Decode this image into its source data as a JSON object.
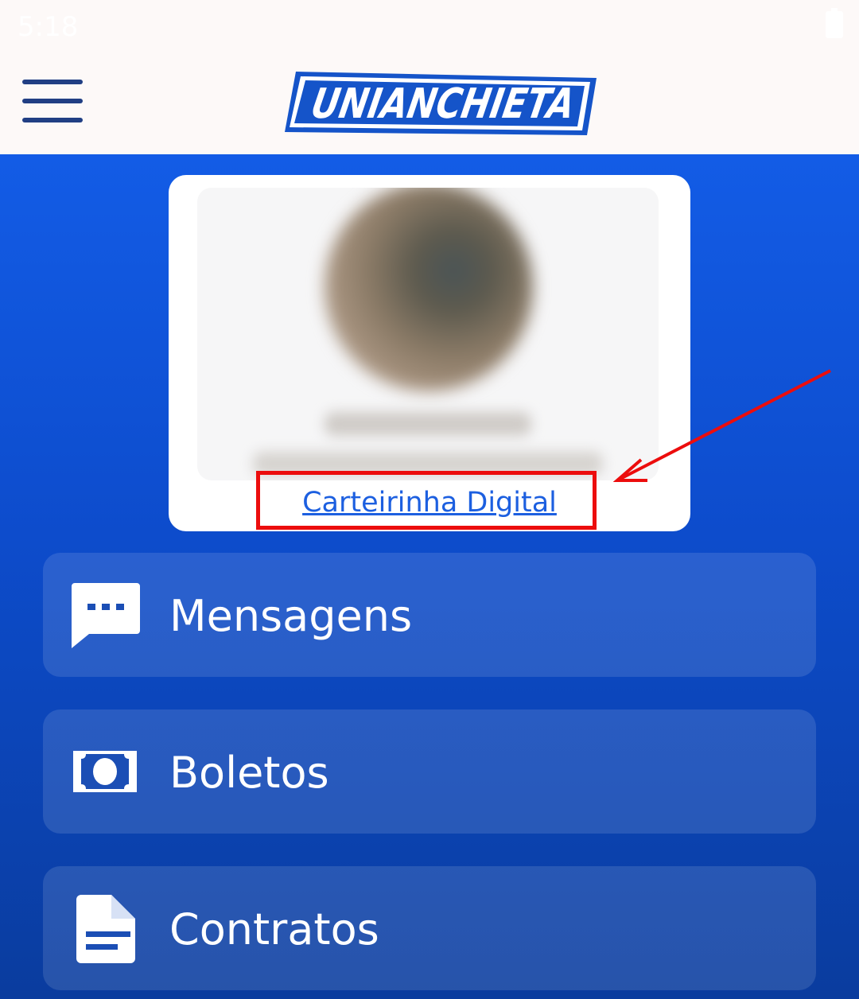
{
  "status_bar": {
    "time": "5:18"
  },
  "header": {
    "logo_text": "UNIANCHIETA",
    "menu_icon": "hamburger-menu-icon"
  },
  "profile": {
    "link_label": "Carteirinha Digital"
  },
  "menu_items": [
    {
      "label": "Mensagens",
      "icon": "chat-bubble-icon"
    },
    {
      "label": "Boletos",
      "icon": "banknote-icon"
    },
    {
      "label": "Contratos",
      "icon": "document-icon"
    }
  ],
  "colors": {
    "brand_blue": "#135ce6",
    "header_blue": "#213f84",
    "highlight_red": "#ec0d0d",
    "link_blue": "#1c5fe0"
  }
}
